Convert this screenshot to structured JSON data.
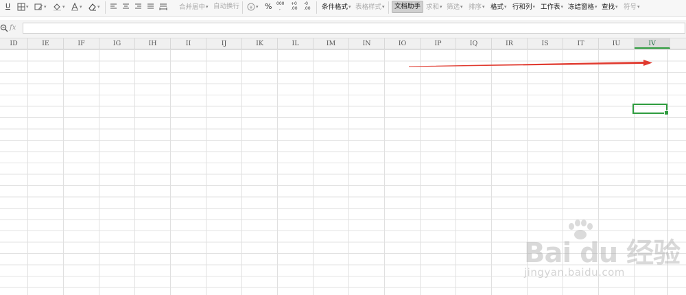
{
  "toolbar": {
    "underline_label": "U",
    "merge_center": "合并居中",
    "wrap_text": "自动换行",
    "percent": "%",
    "thousands_top": "000",
    "decimal_inc": "+.0\n.00",
    "decimal_inc_top": "+0",
    "decimal_inc_bot": ".00",
    "decimal_dec_top": "-0",
    "decimal_dec_bot": ".00",
    "conditional_format": "条件格式",
    "table_style": "表格样式",
    "doc_assistant": "文档助手",
    "sum": "求和",
    "filter": "筛选",
    "sort": "排序",
    "format": "格式",
    "row_col": "行和列",
    "worksheet": "工作表",
    "freeze_panes": "冻结窗格",
    "find": "查找",
    "symbol": "符号",
    "caret": "▾"
  },
  "formula_bar": {
    "fx": "fx",
    "value": "",
    "placeholder": ""
  },
  "sheet": {
    "columns": [
      "ID",
      "IE",
      "IF",
      "IG",
      "IH",
      "II",
      "IJ",
      "IK",
      "IL",
      "IM",
      "IN",
      "IO",
      "IP",
      "IQ",
      "IR",
      "IS",
      "IT",
      "IU",
      "IV"
    ],
    "selected_column": "IV"
  },
  "colors": {
    "accent_green": "#2e9c3e",
    "annotation_red": "#e03a2f"
  },
  "watermark": {
    "logo_text": "Bai du 经验",
    "url": "jingyan.baidu.com"
  },
  "icons": [
    "border-icon",
    "cell-style-icon",
    "fill-color-icon",
    "font-color-icon",
    "eraser-icon",
    "align-left-icon",
    "align-center-icon",
    "align-right-icon",
    "justify-icon",
    "distributed-icon",
    "currency-icon",
    "zoom-icon",
    "paw-icon"
  ]
}
